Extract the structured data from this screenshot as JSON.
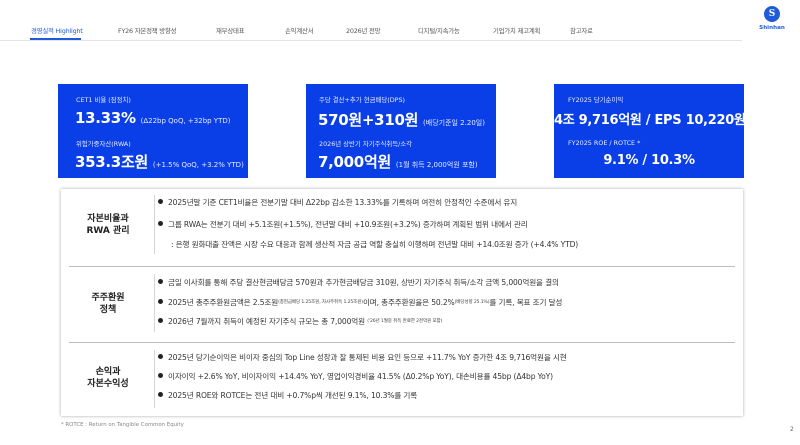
{
  "nav": {
    "items": [
      "경영실적 Highlight",
      "FY26 자본정책 방향성",
      "재무상태표",
      "손익계산서",
      "2026년 전망",
      "디지털/지속가능",
      "기업가치 제고계획",
      "참고자료"
    ],
    "active_index": 0
  },
  "brand": {
    "mark": "S",
    "name": "Shinhan",
    "color": "#1f5bd8"
  },
  "cards": [
    {
      "label1": "CET1 비율 (잠정치)",
      "value1": "13.33%",
      "note1": "(Δ22bp QoQ, +32bp YTD)",
      "label2": "위험가중자산(RWA)",
      "value2": "353.3조원",
      "note2": "(+1.5% QoQ, +3.2% YTD)"
    },
    {
      "label1": "주당 결산+추가 현금배당(DPS)",
      "value1": "570원+310원",
      "note1": "(배당기준일 2.20일)",
      "label2": "2026년 상반기 자기주식취득/소각",
      "value2": "7,000억원",
      "note2": "(1월 취득 2,000억원 포함)"
    },
    {
      "label1": "FY2025 당기순이익",
      "value1": "4조 9,716억원 / EPS 10,220원",
      "label2": "FY2025 ROE / ROTCE *",
      "value2": "9.1% / 10.3%"
    }
  ],
  "sections": [
    {
      "title_line1": "자본비율과",
      "title_line2": "RWA 관리",
      "bullet1": "2025년말 기준 CET1비율은 전분기말 대비 Δ22bp 감소한 13.33%를 기록하며 여전히 안정적인 수준에서 유지",
      "bullet2": "그룹 RWA는 전분기 대비 +5.1조원(+1.5%), 전년말 대비 +10.9조원(+3.2%) 증가하며 계획된 범위 내에서 관리",
      "sub": ": 은행 원화대출 잔액은 시장 수요 대응과 함께 생산적 자금 공급 역할 충실히 이행하며 전년말 대비 +14.0조원 증가 (+4.4% YTD)"
    },
    {
      "title_line1": "주주환원",
      "title_line2": "정책",
      "bullet1": "금일 이사회를 통해 주당 결산현금배당금 570원과 추가현금배당금 310원, 상반기 자기주식 취득/소각 금액 5,000억원을 결의",
      "bullet2_a": "2025년 총주주환원금액은 2.5조원",
      "bullet2_tiny1": "(총현금배당 1.25조원, 자사주취득 1.25조원)",
      "bullet2_b": "이며, 총주주환원율은 50.2%",
      "bullet2_tiny2": "(배당성향 25.1%)",
      "bullet2_c": "를 기록, 목표 조기 달성",
      "bullet3_a": "2026년 7월까지 취득이 예정된 자기주식 규모는 총 7,000억원",
      "bullet3_tiny": "('26년 1월중 취득 완료한 2천억원 포함)"
    },
    {
      "title_line1": "손익과",
      "title_line2": "자본수익성",
      "bullet1": "2025년 당기순이익은 비이자 중심의 Top Line 성장과 잘 통제된 비용 요인 등으로 +11.7% YoY 증가한 4조 9,716억원을 시현",
      "bullet2": "이자이익 +2.6% YoY, 비이자이익 +14.4% YoY, 영업이익경비율 41.5% (Δ0.2%p YoY), 대손비용률 45bp (Δ4bp YoY)",
      "bullet3": "2025년 ROE와 ROTCE는 전년 대비 +0.7%p씩 개선된 9.1%, 10.3%를 기록"
    }
  ],
  "footnote": "* ROTCE : Return on Tangible Common Equity",
  "page_number": "2"
}
